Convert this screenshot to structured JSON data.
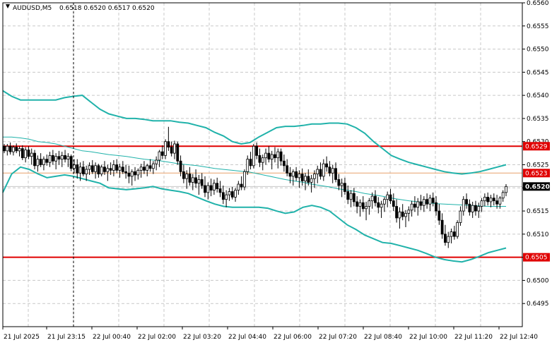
{
  "header": {
    "symbol": "AUDUSD,M5",
    "ohlc": "0.6518 0.6520 0.6517 0.6520"
  },
  "colors": {
    "bull_body": "#ffffff",
    "bear_body": "#000000",
    "wick": "#000000",
    "bollinger_outer": "#20b2aa",
    "bollinger_mid": "#20b2aa",
    "resistance_line": "#e00000",
    "support_line": "#e00000",
    "mid_line": "#e8a06a",
    "current_price_tag": "#000000"
  },
  "chart_data": {
    "type": "candlestick",
    "symbol": "AUDUSD",
    "timeframe": "M5",
    "y_range": [
      0.649,
      0.656
    ],
    "y_ticks": [
      0.6495,
      0.65,
      0.6505,
      0.651,
      0.6515,
      0.652,
      0.6525,
      0.653,
      0.6535,
      0.654,
      0.6545,
      0.655,
      0.6555,
      0.656
    ],
    "y_tick_labels": [
      "0.6495",
      "0.6500",
      "0.6505",
      "0.6510",
      "0.6515",
      "0.6520",
      "0.6525",
      "0.6530",
      "0.6535",
      "0.6540",
      "0.6545",
      "0.6550",
      "0.6555",
      "0.6560"
    ],
    "x_tick_labels": [
      "21 Jul 2025",
      "21 Jul 23:15",
      "22 Jul 00:40",
      "22 Jul 02:00",
      "22 Jul 03:20",
      "22 Jul 04:40",
      "22 Jul 06:00",
      "22 Jul 07:20",
      "22 Jul 08:40",
      "22 Jul 10:00",
      "22 Jul 11:20",
      "22 Jul 12:40"
    ],
    "horizontal_levels": [
      {
        "label": "0.6529",
        "price": 0.6529,
        "style": "resistance"
      },
      {
        "label": "0.6523",
        "price": 0.65232,
        "style": "mid"
      },
      {
        "label": "0.6520",
        "price": 0.65203,
        "style": "current"
      },
      {
        "label": "0.6505",
        "price": 0.6505,
        "style": "support"
      }
    ],
    "vertical_marker_index": 24,
    "candles": [
      [
        0.6529,
        0.65295,
        0.65275,
        0.6528
      ],
      [
        0.6528,
        0.65295,
        0.6527,
        0.6529
      ],
      [
        0.6529,
        0.65298,
        0.65272,
        0.65278
      ],
      [
        0.65278,
        0.65292,
        0.6527,
        0.65288
      ],
      [
        0.65288,
        0.65296,
        0.65275,
        0.6528
      ],
      [
        0.6528,
        0.6529,
        0.65268,
        0.65285
      ],
      [
        0.65285,
        0.65292,
        0.6526,
        0.65265
      ],
      [
        0.65265,
        0.65288,
        0.65255,
        0.65282
      ],
      [
        0.65282,
        0.6529,
        0.65262,
        0.65268
      ],
      [
        0.65268,
        0.65285,
        0.6525,
        0.65275
      ],
      [
        0.65275,
        0.65282,
        0.6524,
        0.65248
      ],
      [
        0.65248,
        0.6527,
        0.65235,
        0.65262
      ],
      [
        0.65262,
        0.65275,
        0.65245,
        0.6525
      ],
      [
        0.6525,
        0.65268,
        0.65238,
        0.65262
      ],
      [
        0.65262,
        0.65272,
        0.65248,
        0.65255
      ],
      [
        0.65255,
        0.65278,
        0.65245,
        0.6527
      ],
      [
        0.6527,
        0.65282,
        0.6525,
        0.65258
      ],
      [
        0.65258,
        0.65275,
        0.6524,
        0.65268
      ],
      [
        0.65268,
        0.6528,
        0.6525,
        0.65262
      ],
      [
        0.65262,
        0.65278,
        0.65245,
        0.6527
      ],
      [
        0.6527,
        0.65282,
        0.65255,
        0.65262
      ],
      [
        0.65262,
        0.65275,
        0.65245,
        0.65268
      ],
      [
        0.65268,
        0.65272,
        0.65236,
        0.65242
      ],
      [
        0.65242,
        0.65262,
        0.65232,
        0.6525
      ],
      [
        0.6525,
        0.65262,
        0.6522,
        0.65232
      ],
      [
        0.65232,
        0.65255,
        0.65215,
        0.65245
      ],
      [
        0.65245,
        0.65258,
        0.65225,
        0.6523
      ],
      [
        0.6523,
        0.65248,
        0.65215,
        0.6524
      ],
      [
        0.6524,
        0.65255,
        0.65228,
        0.65248
      ],
      [
        0.65248,
        0.6526,
        0.6523,
        0.65235
      ],
      [
        0.65235,
        0.65255,
        0.6522,
        0.65248
      ],
      [
        0.65248,
        0.65252,
        0.65222,
        0.6523
      ],
      [
        0.6523,
        0.6525,
        0.65225,
        0.65245
      ],
      [
        0.65245,
        0.65258,
        0.65228,
        0.65235
      ],
      [
        0.65235,
        0.6525,
        0.65215,
        0.65242
      ],
      [
        0.65242,
        0.65255,
        0.65228,
        0.65238
      ],
      [
        0.65238,
        0.6526,
        0.65225,
        0.6525
      ],
      [
        0.6525,
        0.65262,
        0.65232,
        0.65238
      ],
      [
        0.65238,
        0.65252,
        0.65222,
        0.65245
      ],
      [
        0.65245,
        0.65258,
        0.6523,
        0.65235
      ],
      [
        0.65235,
        0.6525,
        0.6522,
        0.65232
      ],
      [
        0.65232,
        0.65248,
        0.6521,
        0.65225
      ],
      [
        0.65225,
        0.6524,
        0.65205,
        0.65235
      ],
      [
        0.65235,
        0.65245,
        0.65215,
        0.65228
      ],
      [
        0.65228,
        0.65242,
        0.65218,
        0.65238
      ],
      [
        0.65238,
        0.65252,
        0.65222,
        0.65245
      ],
      [
        0.65245,
        0.65258,
        0.6523,
        0.65238
      ],
      [
        0.65238,
        0.65252,
        0.65225,
        0.65248
      ],
      [
        0.65248,
        0.65262,
        0.65235,
        0.65242
      ],
      [
        0.65242,
        0.65258,
        0.6523,
        0.65252
      ],
      [
        0.65252,
        0.65268,
        0.65238,
        0.6526
      ],
      [
        0.6526,
        0.65282,
        0.65245,
        0.65278
      ],
      [
        0.65278,
        0.65292,
        0.65262,
        0.6527
      ],
      [
        0.6527,
        0.65305,
        0.65262,
        0.653
      ],
      [
        0.653,
        0.65332,
        0.6528,
        0.65288
      ],
      [
        0.65288,
        0.653,
        0.65268,
        0.65275
      ],
      [
        0.65275,
        0.65302,
        0.65262,
        0.65295
      ],
      [
        0.65295,
        0.653,
        0.6525,
        0.65258
      ],
      [
        0.65258,
        0.6527,
        0.65225,
        0.65235
      ],
      [
        0.65235,
        0.6525,
        0.6521,
        0.6522
      ],
      [
        0.6522,
        0.65238,
        0.65198,
        0.6523
      ],
      [
        0.6523,
        0.65245,
        0.65205,
        0.65212
      ],
      [
        0.65212,
        0.6523,
        0.65195,
        0.65222
      ],
      [
        0.65222,
        0.6524,
        0.652,
        0.6521
      ],
      [
        0.6521,
        0.65228,
        0.65185,
        0.65218
      ],
      [
        0.65218,
        0.65232,
        0.65198,
        0.65205
      ],
      [
        0.65205,
        0.65225,
        0.6518,
        0.6519
      ],
      [
        0.6519,
        0.65212,
        0.65175,
        0.65205
      ],
      [
        0.65205,
        0.6522,
        0.65182,
        0.65195
      ],
      [
        0.65195,
        0.65218,
        0.65185,
        0.6521
      ],
      [
        0.6521,
        0.65222,
        0.6519,
        0.65198
      ],
      [
        0.65198,
        0.65215,
        0.6518,
        0.6519
      ],
      [
        0.6519,
        0.65205,
        0.65165,
        0.65175
      ],
      [
        0.65175,
        0.65195,
        0.65158,
        0.65185
      ],
      [
        0.65185,
        0.652,
        0.65172,
        0.65192
      ],
      [
        0.65192,
        0.65202,
        0.65175,
        0.6518
      ],
      [
        0.6518,
        0.652,
        0.6517,
        0.65195
      ],
      [
        0.65195,
        0.65215,
        0.65185,
        0.65208
      ],
      [
        0.65208,
        0.65225,
        0.65195,
        0.65202
      ],
      [
        0.65202,
        0.6524,
        0.65195,
        0.65235
      ],
      [
        0.65235,
        0.6527,
        0.65228,
        0.65262
      ],
      [
        0.65262,
        0.65278,
        0.6524,
        0.65248
      ],
      [
        0.65248,
        0.65295,
        0.65242,
        0.6529
      ],
      [
        0.6529,
        0.65298,
        0.65262,
        0.6527
      ],
      [
        0.6527,
        0.65285,
        0.65245,
        0.65255
      ],
      [
        0.65255,
        0.65272,
        0.65238,
        0.65265
      ],
      [
        0.65265,
        0.65285,
        0.6525,
        0.65275
      ],
      [
        0.65275,
        0.6529,
        0.65255,
        0.65262
      ],
      [
        0.65262,
        0.6528,
        0.6524,
        0.65272
      ],
      [
        0.65272,
        0.65288,
        0.65255,
        0.65265
      ],
      [
        0.65265,
        0.65285,
        0.65242,
        0.65278
      ],
      [
        0.65278,
        0.65285,
        0.65248,
        0.65258
      ],
      [
        0.65258,
        0.65272,
        0.65235,
        0.65248
      ],
      [
        0.65248,
        0.65262,
        0.65225,
        0.65232
      ],
      [
        0.65232,
        0.65245,
        0.6521,
        0.65225
      ],
      [
        0.65225,
        0.6524,
        0.65205,
        0.65235
      ],
      [
        0.65235,
        0.65245,
        0.65215,
        0.65222
      ],
      [
        0.65222,
        0.65238,
        0.652,
        0.6523
      ],
      [
        0.6523,
        0.65242,
        0.65205,
        0.65215
      ],
      [
        0.65215,
        0.65232,
        0.65195,
        0.65225
      ],
      [
        0.65225,
        0.6524,
        0.65205,
        0.65212
      ],
      [
        0.65212,
        0.65228,
        0.6519,
        0.6522
      ],
      [
        0.6522,
        0.65238,
        0.652,
        0.6523
      ],
      [
        0.6523,
        0.65248,
        0.6521,
        0.6524
      ],
      [
        0.6524,
        0.65255,
        0.65218,
        0.65225
      ],
      [
        0.65225,
        0.65262,
        0.65215,
        0.65252
      ],
      [
        0.65252,
        0.65268,
        0.65235,
        0.65245
      ],
      [
        0.65245,
        0.65258,
        0.65225,
        0.65232
      ],
      [
        0.65232,
        0.6525,
        0.6521,
        0.65242
      ],
      [
        0.65242,
        0.65255,
        0.65212,
        0.65218
      ],
      [
        0.65218,
        0.6523,
        0.65195,
        0.65205
      ],
      [
        0.65205,
        0.6522,
        0.6518,
        0.6521
      ],
      [
        0.6521,
        0.65222,
        0.65185,
        0.65192
      ],
      [
        0.65192,
        0.65205,
        0.65165,
        0.65175
      ],
      [
        0.65175,
        0.65195,
        0.65158,
        0.65188
      ],
      [
        0.65188,
        0.652,
        0.6516,
        0.6517
      ],
      [
        0.6517,
        0.65182,
        0.65145,
        0.6516
      ],
      [
        0.6516,
        0.65175,
        0.65138,
        0.65168
      ],
      [
        0.65168,
        0.65182,
        0.65148,
        0.65155
      ],
      [
        0.65155,
        0.6517,
        0.6513,
        0.6516
      ],
      [
        0.6516,
        0.65178,
        0.65142,
        0.65172
      ],
      [
        0.65172,
        0.6519,
        0.65155,
        0.65182
      ],
      [
        0.65182,
        0.65195,
        0.6516,
        0.65168
      ],
      [
        0.65168,
        0.6518,
        0.65145,
        0.65158
      ],
      [
        0.65158,
        0.65172,
        0.65135,
        0.65165
      ],
      [
        0.65165,
        0.6518,
        0.65148,
        0.65175
      ],
      [
        0.65175,
        0.65192,
        0.65158,
        0.65185
      ],
      [
        0.65185,
        0.65198,
        0.65165,
        0.65172
      ],
      [
        0.65172,
        0.65188,
        0.6515,
        0.6516
      ],
      [
        0.6516,
        0.65175,
        0.65125,
        0.65135
      ],
      [
        0.65135,
        0.65158,
        0.65112,
        0.65148
      ],
      [
        0.65148,
        0.65165,
        0.6513,
        0.65138
      ],
      [
        0.65138,
        0.65152,
        0.65115,
        0.65145
      ],
      [
        0.65145,
        0.6516,
        0.65128,
        0.65152
      ],
      [
        0.65152,
        0.65172,
        0.65138,
        0.65165
      ],
      [
        0.65165,
        0.65182,
        0.65148,
        0.65158
      ],
      [
        0.65158,
        0.65178,
        0.6514,
        0.6517
      ],
      [
        0.6517,
        0.65185,
        0.65152,
        0.65162
      ],
      [
        0.65162,
        0.65182,
        0.65148,
        0.65175
      ],
      [
        0.65175,
        0.65188,
        0.65155,
        0.65165
      ],
      [
        0.65165,
        0.65185,
        0.6515,
        0.65178
      ],
      [
        0.65178,
        0.6519,
        0.6516,
        0.65168
      ],
      [
        0.65168,
        0.65182,
        0.6514,
        0.6515
      ],
      [
        0.6515,
        0.65165,
        0.6512,
        0.6513
      ],
      [
        0.6513,
        0.65145,
        0.6509,
        0.651
      ],
      [
        0.651,
        0.6512,
        0.65075,
        0.65082
      ],
      [
        0.65082,
        0.65105,
        0.6507,
        0.65095
      ],
      [
        0.65095,
        0.65112,
        0.6508,
        0.65105
      ],
      [
        0.65105,
        0.65118,
        0.65088,
        0.65095
      ],
      [
        0.65095,
        0.6513,
        0.6509,
        0.65125
      ],
      [
        0.65125,
        0.6516,
        0.65118,
        0.6515
      ],
      [
        0.6515,
        0.65182,
        0.6514,
        0.65175
      ],
      [
        0.65175,
        0.65188,
        0.65155,
        0.65165
      ],
      [
        0.65165,
        0.65175,
        0.6514,
        0.65148
      ],
      [
        0.65148,
        0.6517,
        0.65135,
        0.65162
      ],
      [
        0.65162,
        0.65172,
        0.6514,
        0.6515
      ],
      [
        0.6515,
        0.65168,
        0.65135,
        0.6516
      ],
      [
        0.6516,
        0.65178,
        0.65148,
        0.65172
      ],
      [
        0.65172,
        0.65188,
        0.6516,
        0.6518
      ],
      [
        0.6518,
        0.6519,
        0.65162,
        0.6517
      ],
      [
        0.6517,
        0.65185,
        0.65158,
        0.65178
      ],
      [
        0.65178,
        0.65188,
        0.65162,
        0.65172
      ],
      [
        0.65172,
        0.65185,
        0.65155,
        0.65165
      ],
      [
        0.65165,
        0.65182,
        0.65155,
        0.65178
      ],
      [
        0.65178,
        0.65195,
        0.6517,
        0.6519
      ],
      [
        0.6519,
        0.65208,
        0.65182,
        0.65203
      ]
    ],
    "bollinger": {
      "upper": [
        0.6541,
        0.65398,
        0.6539,
        0.6539,
        0.6539,
        0.6539,
        0.6539,
        0.65395,
        0.65398,
        0.654,
        0.65385,
        0.6537,
        0.6536,
        0.65355,
        0.6535,
        0.6535,
        0.65348,
        0.65345,
        0.65345,
        0.65345,
        0.65342,
        0.6534,
        0.65335,
        0.6533,
        0.6532,
        0.65312,
        0.653,
        0.65295,
        0.65298,
        0.6531,
        0.6532,
        0.6533,
        0.65333,
        0.65333,
        0.65335,
        0.65338,
        0.65338,
        0.6534,
        0.6534,
        0.65338,
        0.6533,
        0.65318,
        0.653,
        0.65285,
        0.6527,
        0.65262,
        0.65255,
        0.6525,
        0.65245,
        0.6524,
        0.65235,
        0.65232,
        0.6523,
        0.65232,
        0.65235,
        0.6524,
        0.65245,
        0.6525
      ],
      "middle": [
        0.6531,
        0.6531,
        0.65308,
        0.65305,
        0.653,
        0.65298,
        0.65295,
        0.6529,
        0.65285,
        0.6528,
        0.65278,
        0.65275,
        0.65272,
        0.6527,
        0.65268,
        0.65265,
        0.65262,
        0.6526,
        0.65258,
        0.65255,
        0.65252,
        0.6525,
        0.65248,
        0.65245,
        0.65242,
        0.6524,
        0.65238,
        0.65236,
        0.65234,
        0.6523,
        0.65226,
        0.65222,
        0.65218,
        0.65215,
        0.65212,
        0.65208,
        0.65205,
        0.65202,
        0.65198,
        0.65195,
        0.65192,
        0.65188,
        0.65185,
        0.65182,
        0.65178,
        0.65175,
        0.65172,
        0.6517,
        0.65168,
        0.65166,
        0.65165,
        0.65164,
        0.65163,
        0.65162,
        0.65161,
        0.6516,
        0.6516,
        0.6516
      ],
      "lower": [
        0.6519,
        0.6523,
        0.65245,
        0.6524,
        0.6523,
        0.65222,
        0.65225,
        0.65228,
        0.65225,
        0.6522,
        0.65215,
        0.6521,
        0.652,
        0.65198,
        0.65196,
        0.65198,
        0.652,
        0.65203,
        0.65198,
        0.65195,
        0.65192,
        0.65188,
        0.6518,
        0.65172,
        0.65165,
        0.6516,
        0.65158,
        0.65158,
        0.65158,
        0.65158,
        0.65156,
        0.6515,
        0.65145,
        0.65148,
        0.65158,
        0.65162,
        0.65158,
        0.6515,
        0.65135,
        0.6512,
        0.6511,
        0.65098,
        0.6509,
        0.65082,
        0.6508,
        0.65075,
        0.6507,
        0.65065,
        0.65058,
        0.6505,
        0.65045,
        0.65042,
        0.6504,
        0.65045,
        0.65052,
        0.6506,
        0.65065,
        0.6507
      ]
    }
  }
}
